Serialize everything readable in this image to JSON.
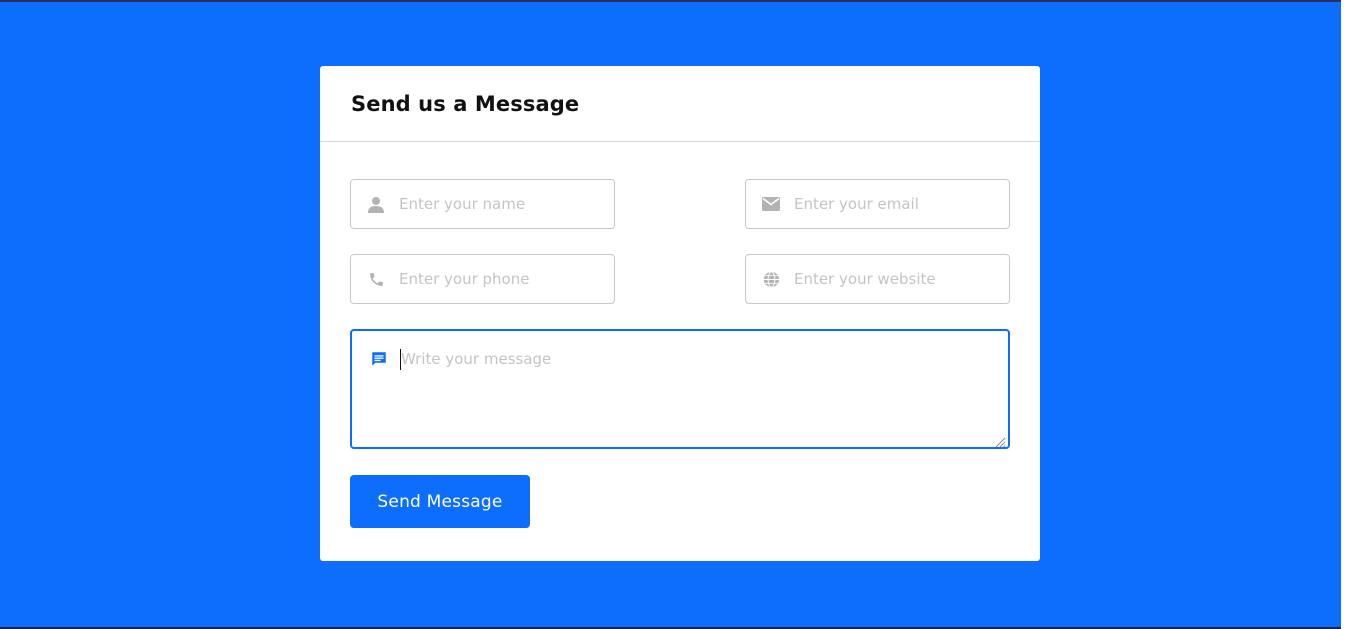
{
  "form": {
    "title": "Send us a Message",
    "fields": {
      "name": {
        "placeholder": "Enter your name",
        "icon": "user-icon"
      },
      "email": {
        "placeholder": "Enter your email",
        "icon": "envelope-icon"
      },
      "phone": {
        "placeholder": "Enter your phone",
        "icon": "phone-icon"
      },
      "website": {
        "placeholder": "Enter your website",
        "icon": "globe-icon"
      }
    },
    "message": {
      "placeholder": "Write your message",
      "icon": "message-icon"
    },
    "submit_label": "Send Message"
  },
  "colors": {
    "accent": "#0d6efd",
    "icon_gray": "#b3b3b3",
    "card_bg": "#ffffff"
  }
}
